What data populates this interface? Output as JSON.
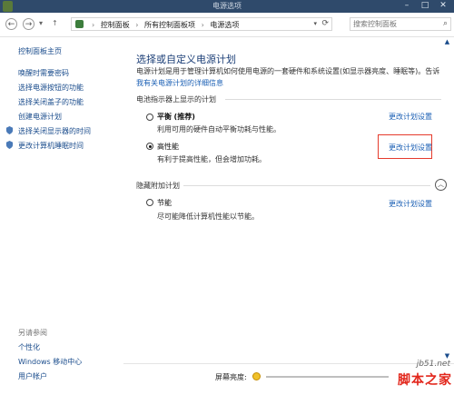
{
  "window": {
    "title": "电源选项",
    "min_icon": "minimize-icon",
    "max_icon": "maximize-icon",
    "close_icon": "close-icon"
  },
  "nav": {
    "back_glyph": "←",
    "forward_glyph": "→",
    "up_glyph": "↑",
    "drop_glyph": "▾"
  },
  "address": {
    "crumbs": [
      "控制面板",
      "所有控制面板项",
      "电源选项"
    ],
    "separator": "›",
    "dropdown_glyph": "▾",
    "refresh_glyph": "⟳"
  },
  "search": {
    "placeholder": "搜索控制面板",
    "icon": "search-icon",
    "glyph": "⌕"
  },
  "sidebar": {
    "home": "控制面板主页",
    "items": [
      "唤醒时需要密码",
      "选择电源按钮的功能",
      "选择关闭盖子的功能",
      "创建电源计划",
      "选择关闭显示器的时间",
      "更改计算机睡眠时间"
    ],
    "see_also_label": "另请参阅",
    "see_also": [
      "个性化",
      "Windows 移动中心",
      "用户帐户"
    ]
  },
  "main": {
    "title": "选择或自定义电源计划",
    "intro": "电源计划是用于管理计算机如何使用电源的一套硬件和系统设置(如显示器亮度、睡眠等)。告诉",
    "intro_link": "我有关电源计划的详细信息",
    "battery_section": "电池指示器上显示的计划",
    "plans": [
      {
        "name": "平衡",
        "suffix": "(推荐)",
        "desc": "利用可用的硬件自动平衡功耗与性能。",
        "link": "更改计划设置",
        "selected": false
      },
      {
        "name": "高性能",
        "suffix": "",
        "desc": "有利于提高性能，但会增加功耗。",
        "link": "更改计划设置",
        "selected": true
      }
    ],
    "hidden_section": "隐藏附加计划",
    "collapse_glyph": "︿",
    "hidden_plans": [
      {
        "name": "节能",
        "desc": "尽可能降低计算机性能以节能。",
        "link": "更改计划设置",
        "selected": false
      }
    ]
  },
  "footer": {
    "brightness_label": "屏幕亮度:"
  },
  "scrollbar": {
    "up_glyph": "▲",
    "down_glyph": "▼"
  },
  "watermark": {
    "top": "jb51.net",
    "main": "脚本之家"
  },
  "colors": {
    "link": "#1a5fb4",
    "title": "#1c3f77",
    "highlight": "#e53b2c",
    "titlebar": "#2f4a6b"
  }
}
